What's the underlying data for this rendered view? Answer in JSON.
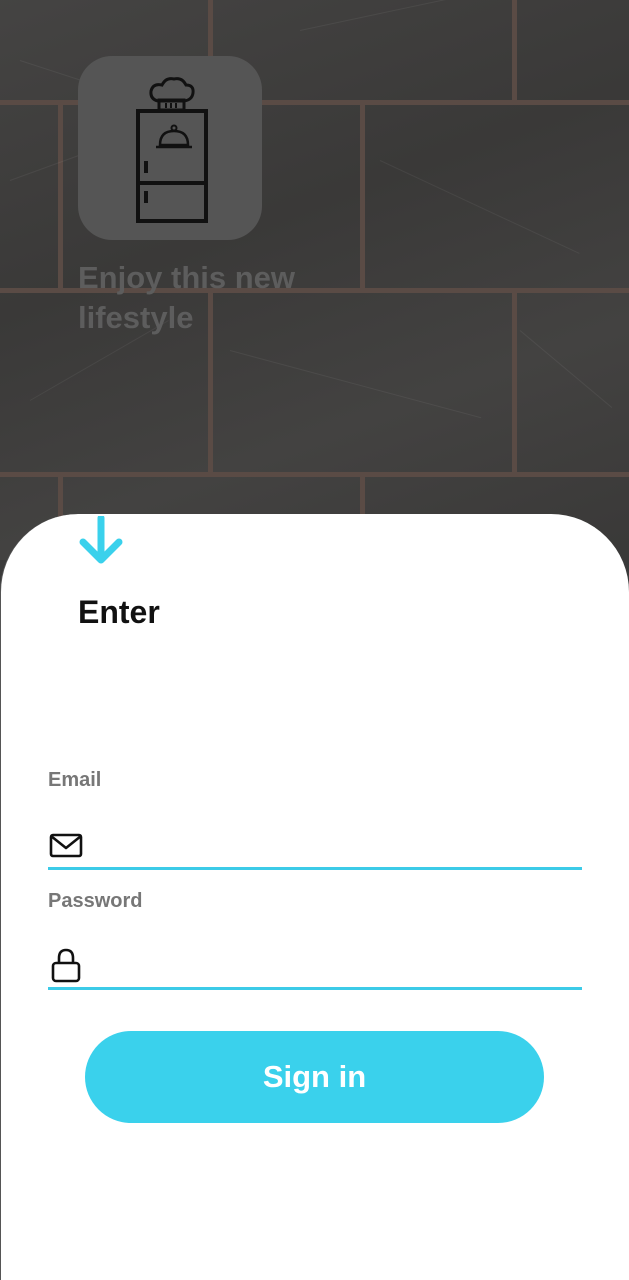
{
  "hero": {
    "tagline": "Enjoy this new lifestyle",
    "app_icon": "fridge-chef-icon"
  },
  "sheet": {
    "title": "Enter",
    "collapse_icon": "arrow-down-icon"
  },
  "form": {
    "email_label": "Email",
    "email_icon": "mail-icon",
    "email_value": "",
    "password_label": "Password",
    "password_icon": "lock-icon",
    "password_value": "",
    "signin_label": "Sign in"
  },
  "colors": {
    "accent": "#3ad1ec",
    "underline": "#3ccbe8",
    "background": "#3d3c3b",
    "sheet": "#ffffff"
  }
}
